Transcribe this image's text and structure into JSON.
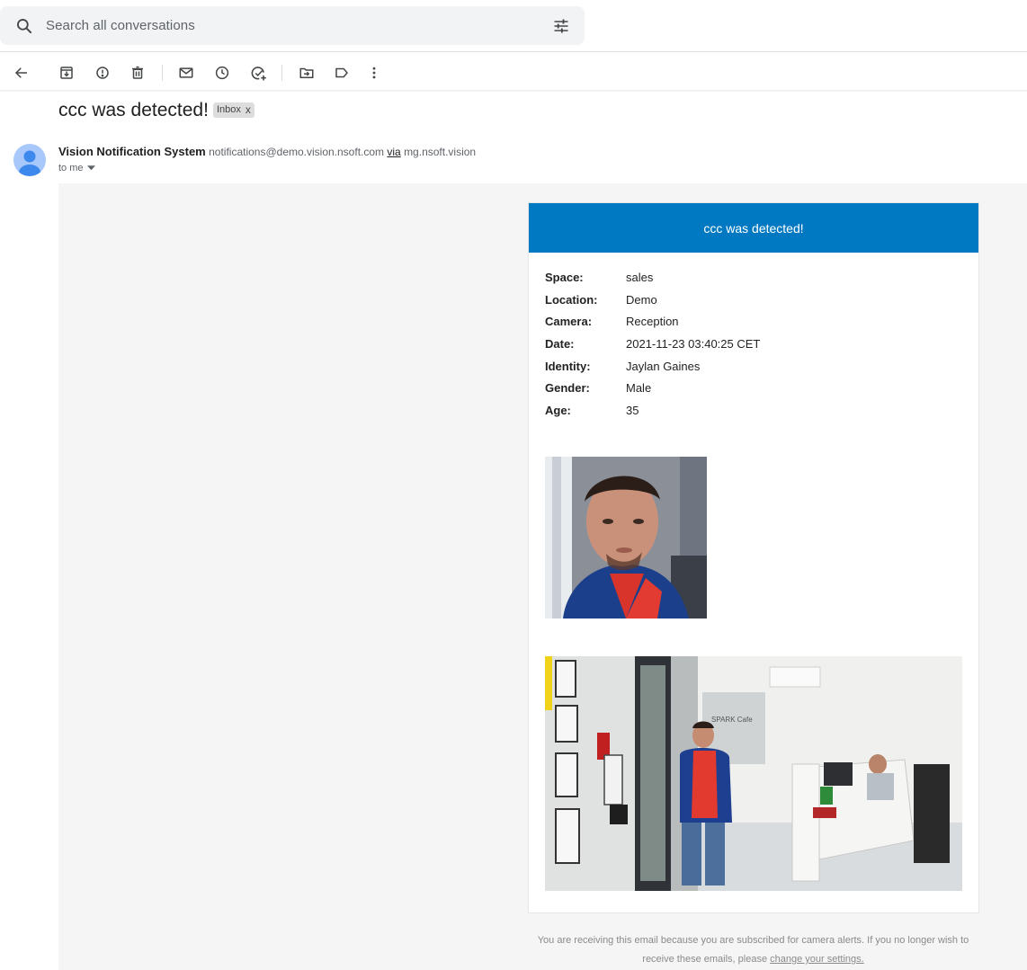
{
  "search": {
    "placeholder": "Search all conversations"
  },
  "toolbar": {
    "buttons": [
      "back-icon",
      "archive-icon",
      "report-spam-icon",
      "delete-icon",
      "mark-unread-icon",
      "snooze-icon",
      "add-to-tasks-icon",
      "move-to-icon",
      "label-icon",
      "more-icon"
    ]
  },
  "message": {
    "subject": "ccc was detected!",
    "label": "Inbox",
    "label_remove": "x",
    "sender_name": "Vision Notification System",
    "sender_email": "notifications@demo.vision.nsoft.com",
    "via": "via",
    "via_domain": "mg.nsoft.vision",
    "to": "to me"
  },
  "email": {
    "header": "ccc was detected!",
    "details": [
      {
        "key": "Space:",
        "value": "sales"
      },
      {
        "key": "Location:",
        "value": "Demo"
      },
      {
        "key": "Camera:",
        "value": "Reception"
      },
      {
        "key": "Date:",
        "value": "2021-11-23 03:40:25 CET"
      },
      {
        "key": "Identity:",
        "value": "Jaylan Gaines"
      },
      {
        "key": "Gender:",
        "value": "Male"
      },
      {
        "key": "Age:",
        "value": "35"
      }
    ],
    "scene_sign": "SPARK Cafe",
    "footer_text": "You are receiving this email because you are subscribed for camera alerts. If you no longer wish to receive these emails, please",
    "footer_link": "change your settings."
  },
  "colors": {
    "header_blue": "#0079c2",
    "body_bg": "#f5f5f5",
    "search_bg": "#f1f3f4"
  }
}
